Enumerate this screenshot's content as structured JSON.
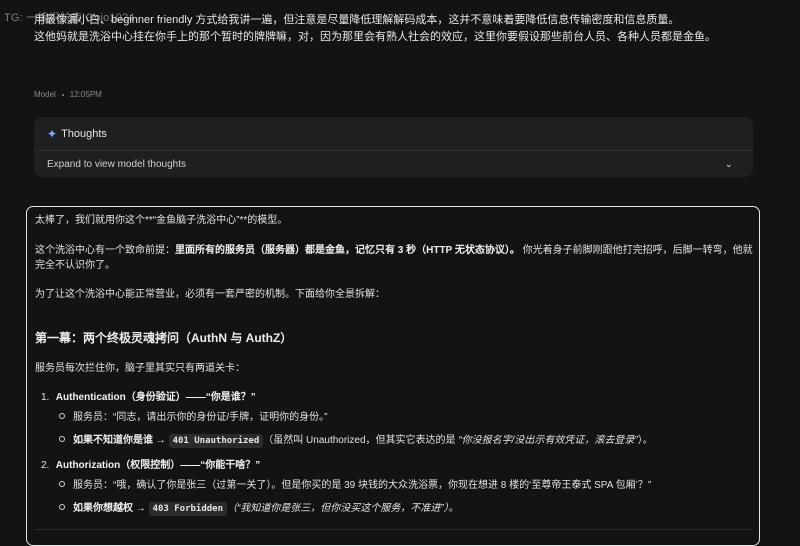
{
  "watermark": "TG: 一编织长夜 Gojo1024",
  "user_message": {
    "line1": "用最像漏小白、beginner friendly 方式给我讲一遍，但注意是尽量降低理解解码成本，这并不意味着要降低信息传输密度和信息质量。",
    "line2": "这他妈就是洗浴中心挂在你手上的那个暂时的牌牌嘛，对，因为那里会有熟人社会的效应，这里你要假设那些前台人员、各种人员都是金鱼。"
  },
  "meta": {
    "author": "Model",
    "time": "12:05PM"
  },
  "thoughts": {
    "title": "Thoughts",
    "expand_label": "Expand to view model thoughts"
  },
  "answer": {
    "p1": "太棒了，我们就用你这个**“金鱼脑子洗浴中心”**的模型。",
    "p2_a": "这个洗浴中心有一个致命前提：",
    "p2_b": "里面所有的服务员（服务器）都是金鱼，记忆只有 3 秒（HTTP 无状态协议）。",
    "p2_c": " 你光着身子前脚刚跟他打完招呼，后脚一转弯，他就完全不认识你了。",
    "p3": "为了让这个洗浴中心能正常营业，必须有一套严密的机制。下面给你全景拆解：",
    "h3": "第一幕：两个终极灵魂拷问（AuthN 与 AuthZ）",
    "p4": "服务员每次拦住你，脑子里其实只有两道关卡：",
    "item1": {
      "num": "1.",
      "title": "Authentication（身份验证）——“你是谁？”"
    },
    "item1_sub1": "服务员：“同志，请出示你的身份证/手牌，证明你的身份。”",
    "item1_sub2": {
      "prefix": "如果不知道你是谁 →",
      "code": "401 Unauthorized",
      "mid": "（虽然叫 Unauthorized，但其实它表达的是 ",
      "ital": "“你没报名字/没出示有效凭证，滚去登录”",
      "end": "）。"
    },
    "item2": {
      "num": "2.",
      "title": "Authorization（权限控制）——“你能干啥？”"
    },
    "item2_sub1": "服务员：“哦，确认了你是张三（过第一关了）。但是你买的是 39 块钱的大众洗浴票，你现在想进 8 楼的‘至尊帝王泰式 SPA 包厢’？”",
    "item2_sub2": {
      "prefix": "如果你想越权 →",
      "code": "403 Forbidden",
      "ital": "（“我知道你是张三，但你没买这个服务，不准进”）",
      "end": "。"
    }
  },
  "colors": {
    "background": "#131314",
    "card": "#1e1f20",
    "accent": "#7ab0ff",
    "border": "#e4e4e4"
  }
}
